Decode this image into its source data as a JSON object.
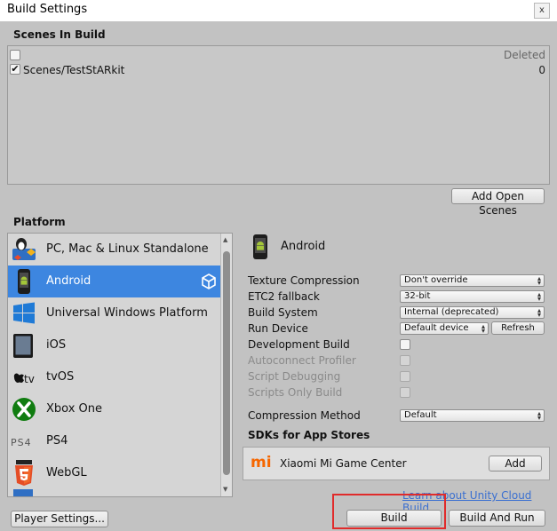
{
  "window": {
    "title": "Build Settings",
    "close_label": "x"
  },
  "scenes": {
    "header": "Scenes In Build",
    "deleted_label": "Deleted",
    "items": [
      {
        "name": "Scenes/TestStARkit",
        "index": "0",
        "checked": true
      }
    ],
    "add_open_scenes_label": "Add Open Scenes"
  },
  "platform": {
    "header": "Platform",
    "items": [
      {
        "name": "PC, Mac & Linux Standalone",
        "icon": "pc-mac-linux-icon"
      },
      {
        "name": "Android",
        "icon": "android-icon",
        "selected": true
      },
      {
        "name": "Universal Windows Platform",
        "icon": "windows-icon"
      },
      {
        "name": "iOS",
        "icon": "ipad-icon"
      },
      {
        "name": "tvOS",
        "icon": "apple-tv-icon"
      },
      {
        "name": "Xbox One",
        "icon": "xbox-icon"
      },
      {
        "name": "PS4",
        "icon": "ps4-icon"
      },
      {
        "name": "WebGL",
        "icon": "html5-icon"
      }
    ]
  },
  "settings": {
    "title": "Android",
    "texture_compression": {
      "label": "Texture Compression",
      "value": "Don't override"
    },
    "etc2_fallback": {
      "label": "ETC2 fallback",
      "value": "32-bit"
    },
    "build_system": {
      "label": "Build System",
      "value": "Internal (deprecated)"
    },
    "run_device": {
      "label": "Run Device",
      "value": "Default device",
      "refresh_label": "Refresh"
    },
    "development_build": {
      "label": "Development Build"
    },
    "autoconnect_profiler": {
      "label": "Autoconnect Profiler"
    },
    "script_debugging": {
      "label": "Script Debugging"
    },
    "scripts_only_build": {
      "label": "Scripts Only Build"
    },
    "compression_method": {
      "label": "Compression Method",
      "value": "Default"
    }
  },
  "sdks": {
    "header": "SDKs for App Stores",
    "items": [
      {
        "name": "Xiaomi Mi Game Center",
        "add_label": "Add",
        "logo_text": "mi"
      }
    ]
  },
  "footer": {
    "cloud_link": "Learn about Unity Cloud Build",
    "player_settings_label": "Player Settings...",
    "build_label": "Build",
    "build_and_run_label": "Build And Run"
  },
  "colors": {
    "selected": "#3d86e0",
    "highlight_outline": "#e02b2b",
    "link": "#3a6fd0",
    "mi_orange": "#f56600"
  }
}
